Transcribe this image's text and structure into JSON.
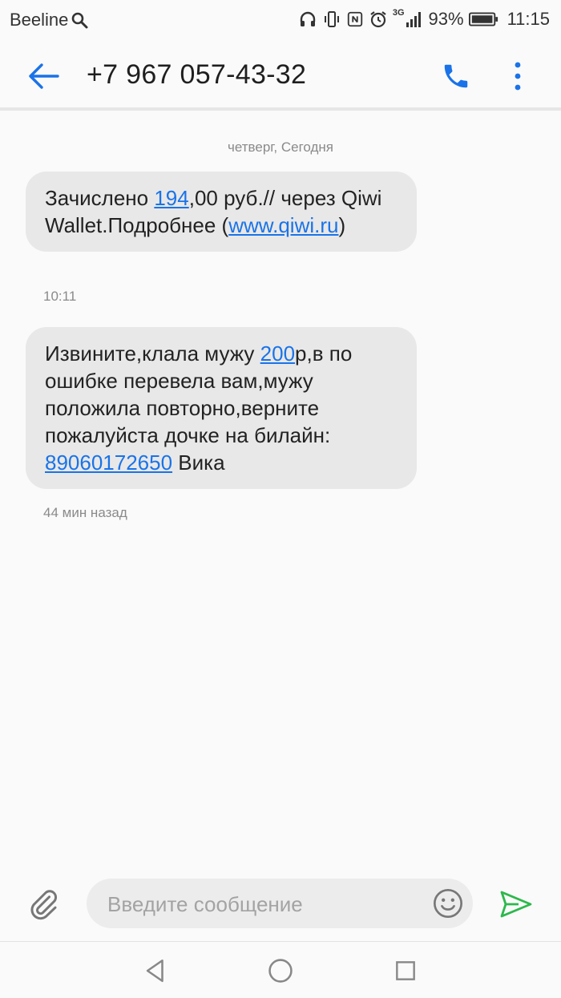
{
  "status_bar": {
    "carrier": "Beeline",
    "network_type": "3G",
    "battery": "93%",
    "time": "11:15",
    "icons": [
      "search-icon",
      "headphones-icon",
      "vibrate-icon",
      "nfc-icon",
      "alarm-icon",
      "signal-icon",
      "battery-icon"
    ]
  },
  "header": {
    "title": "+7 967 057-43-32",
    "back_icon": "arrow-left-icon",
    "call_icon": "phone-icon",
    "menu_icon": "more-vert-icon"
  },
  "conversation": {
    "date_separator": "четверг, Сегодня",
    "messages": [
      {
        "parts": [
          {
            "text": "Зачислено "
          },
          {
            "text": "194",
            "link": true
          },
          {
            "text": ",00 руб.// через Qiwi Wallet.Подробнее ("
          },
          {
            "text": "www.qiwi.ru",
            "link": true
          },
          {
            "text": ")"
          }
        ],
        "time": "10:11"
      },
      {
        "parts": [
          {
            "text": "Извините,клала мужу "
          },
          {
            "text": "200",
            "link": true
          },
          {
            "text": "р,в по ошибке перевела вам,мужу положила повторно,верните пожалуйста дочке на билайн: "
          },
          {
            "text": "89060172650",
            "link": true
          },
          {
            "text": " Вика"
          }
        ],
        "time": "44 мин назад"
      }
    ]
  },
  "compose": {
    "placeholder": "Введите сообщение",
    "value": "",
    "attach_icon": "paperclip-icon",
    "emoji_icon": "smiley-icon",
    "send_icon": "send-icon"
  },
  "nav_bar": {
    "icons": [
      "back-triangle-icon",
      "home-circle-icon",
      "recents-square-icon"
    ]
  },
  "colors": {
    "accent": "#1a73e8",
    "send": "#2db84c",
    "bubble": "#e8e8e8",
    "background": "#fafafa"
  }
}
